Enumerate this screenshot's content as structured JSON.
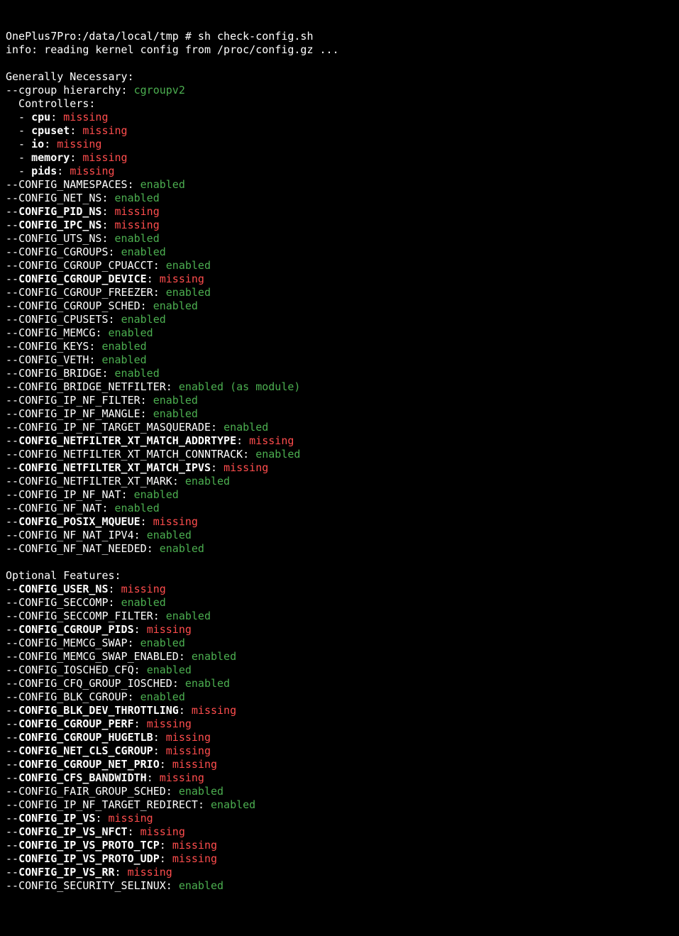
{
  "prompt": "OnePlus7Pro:/data/local/tmp # sh check-config.sh",
  "info_line": "info: reading kernel config from /proc/config.gz ...",
  "section1_title": "Generally Necessary:",
  "cgroup_hierarchy_label": "--cgroup hierarchy: ",
  "cgroup_hierarchy_value": "cgroupv2",
  "controllers_label": "  Controllers:",
  "controllers": [
    {
      "name": "cpu",
      "status": "missing"
    },
    {
      "name": "cpuset",
      "status": "missing"
    },
    {
      "name": "io",
      "status": "missing"
    },
    {
      "name": "memory",
      "status": "missing"
    },
    {
      "name": "pids",
      "status": "missing"
    }
  ],
  "generally_necessary": [
    {
      "name": "CONFIG_NAMESPACES",
      "status": "enabled",
      "bold": false
    },
    {
      "name": "CONFIG_NET_NS",
      "status": "enabled",
      "bold": false
    },
    {
      "name": "CONFIG_PID_NS",
      "status": "missing",
      "bold": true
    },
    {
      "name": "CONFIG_IPC_NS",
      "status": "missing",
      "bold": true
    },
    {
      "name": "CONFIG_UTS_NS",
      "status": "enabled",
      "bold": false
    },
    {
      "name": "CONFIG_CGROUPS",
      "status": "enabled",
      "bold": false
    },
    {
      "name": "CONFIG_CGROUP_CPUACCT",
      "status": "enabled",
      "bold": false
    },
    {
      "name": "CONFIG_CGROUP_DEVICE",
      "status": "missing",
      "bold": true
    },
    {
      "name": "CONFIG_CGROUP_FREEZER",
      "status": "enabled",
      "bold": false
    },
    {
      "name": "CONFIG_CGROUP_SCHED",
      "status": "enabled",
      "bold": false
    },
    {
      "name": "CONFIG_CPUSETS",
      "status": "enabled",
      "bold": false
    },
    {
      "name": "CONFIG_MEMCG",
      "status": "enabled",
      "bold": false
    },
    {
      "name": "CONFIG_KEYS",
      "status": "enabled",
      "bold": false
    },
    {
      "name": "CONFIG_VETH",
      "status": "enabled",
      "bold": false
    },
    {
      "name": "CONFIG_BRIDGE",
      "status": "enabled",
      "bold": false
    },
    {
      "name": "CONFIG_BRIDGE_NETFILTER",
      "status": "enabled (as module)",
      "bold": false
    },
    {
      "name": "CONFIG_IP_NF_FILTER",
      "status": "enabled",
      "bold": false
    },
    {
      "name": "CONFIG_IP_NF_MANGLE",
      "status": "enabled",
      "bold": false
    },
    {
      "name": "CONFIG_IP_NF_TARGET_MASQUERADE",
      "status": "enabled",
      "bold": false
    },
    {
      "name": "CONFIG_NETFILTER_XT_MATCH_ADDRTYPE",
      "status": "missing",
      "bold": true
    },
    {
      "name": "CONFIG_NETFILTER_XT_MATCH_CONNTRACK",
      "status": "enabled",
      "bold": false
    },
    {
      "name": "CONFIG_NETFILTER_XT_MATCH_IPVS",
      "status": "missing",
      "bold": true
    },
    {
      "name": "CONFIG_NETFILTER_XT_MARK",
      "status": "enabled",
      "bold": false
    },
    {
      "name": "CONFIG_IP_NF_NAT",
      "status": "enabled",
      "bold": false
    },
    {
      "name": "CONFIG_NF_NAT",
      "status": "enabled",
      "bold": false
    },
    {
      "name": "CONFIG_POSIX_MQUEUE",
      "status": "missing",
      "bold": true
    },
    {
      "name": "CONFIG_NF_NAT_IPV4",
      "status": "enabled",
      "bold": false
    },
    {
      "name": "CONFIG_NF_NAT_NEEDED",
      "status": "enabled",
      "bold": false
    }
  ],
  "section2_title": "Optional Features:",
  "optional_features": [
    {
      "name": "CONFIG_USER_NS",
      "status": "missing",
      "bold": true
    },
    {
      "name": "CONFIG_SECCOMP",
      "status": "enabled",
      "bold": false
    },
    {
      "name": "CONFIG_SECCOMP_FILTER",
      "status": "enabled",
      "bold": false
    },
    {
      "name": "CONFIG_CGROUP_PIDS",
      "status": "missing",
      "bold": true
    },
    {
      "name": "CONFIG_MEMCG_SWAP",
      "status": "enabled",
      "bold": false
    },
    {
      "name": "CONFIG_MEMCG_SWAP_ENABLED",
      "status": "enabled",
      "bold": false
    },
    {
      "name": "CONFIG_IOSCHED_CFQ",
      "status": "enabled",
      "bold": false
    },
    {
      "name": "CONFIG_CFQ_GROUP_IOSCHED",
      "status": "enabled",
      "bold": false
    },
    {
      "name": "CONFIG_BLK_CGROUP",
      "status": "enabled",
      "bold": false
    },
    {
      "name": "CONFIG_BLK_DEV_THROTTLING",
      "status": "missing",
      "bold": true
    },
    {
      "name": "CONFIG_CGROUP_PERF",
      "status": "missing",
      "bold": true
    },
    {
      "name": "CONFIG_CGROUP_HUGETLB",
      "status": "missing",
      "bold": true
    },
    {
      "name": "CONFIG_NET_CLS_CGROUP",
      "status": "missing",
      "bold": true
    },
    {
      "name": "CONFIG_CGROUP_NET_PRIO",
      "status": "missing",
      "bold": true
    },
    {
      "name": "CONFIG_CFS_BANDWIDTH",
      "status": "missing",
      "bold": true
    },
    {
      "name": "CONFIG_FAIR_GROUP_SCHED",
      "status": "enabled",
      "bold": false
    },
    {
      "name": "CONFIG_IP_NF_TARGET_REDIRECT",
      "status": "enabled",
      "bold": false
    },
    {
      "name": "CONFIG_IP_VS",
      "status": "missing",
      "bold": true
    },
    {
      "name": "CONFIG_IP_VS_NFCT",
      "status": "missing",
      "bold": true
    },
    {
      "name": "CONFIG_IP_VS_PROTO_TCP",
      "status": "missing",
      "bold": true
    },
    {
      "name": "CONFIG_IP_VS_PROTO_UDP",
      "status": "missing",
      "bold": true
    },
    {
      "name": "CONFIG_IP_VS_RR",
      "status": "missing",
      "bold": true
    },
    {
      "name": "CONFIG_SECURITY_SELINUX",
      "status": "enabled",
      "bold": false
    }
  ]
}
